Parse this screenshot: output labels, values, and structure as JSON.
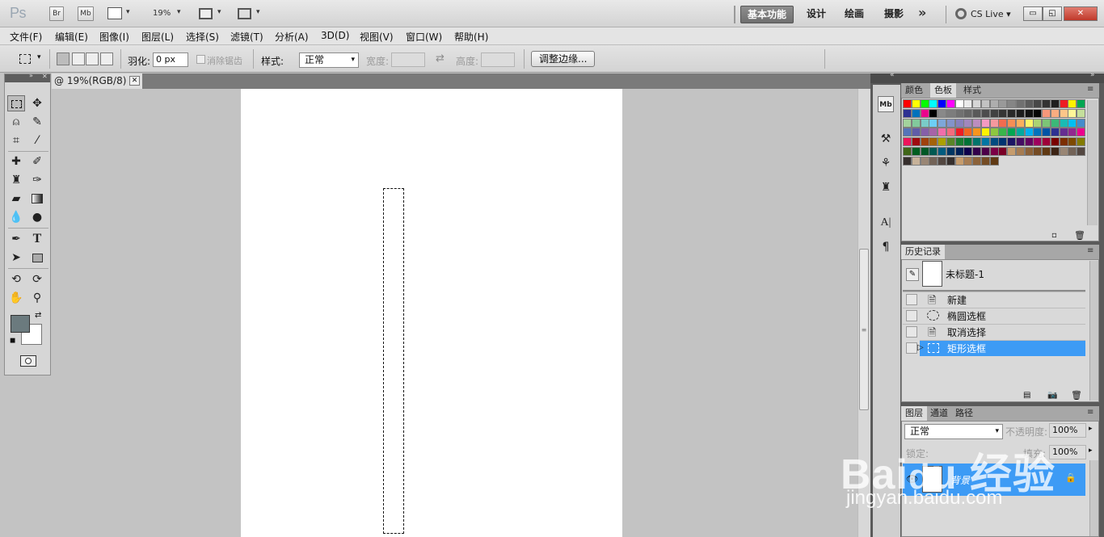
{
  "appbar": {
    "logo": "Ps",
    "br": "Br",
    "mb": "Mb",
    "zoom": "19%",
    "dropdown": "▾",
    "workspaces": [
      "基本功能",
      "设计",
      "绘画",
      "摄影"
    ],
    "more": "»",
    "cslive": "CS Live",
    "win_min": "▭",
    "win_max": "◱",
    "win_close": "✕"
  },
  "menu": [
    "文件(F)",
    "编辑(E)",
    "图像(I)",
    "图层(L)",
    "选择(S)",
    "滤镜(T)",
    "分析(A)",
    "3D(D)",
    "视图(V)",
    "窗口(W)",
    "帮助(H)"
  ],
  "options": {
    "feather_label": "羽化:",
    "feather_value": "0 px",
    "antialias_label": "消除锯齿",
    "style_label": "样式:",
    "style_value": "正常",
    "width_label": "宽度:",
    "height_label": "高度:",
    "refine_button": "调整边缘..."
  },
  "document": {
    "tab_title": "@ 19%(RGB/8) *",
    "tab_close": "✕"
  },
  "panels": {
    "color_tabs": [
      "颜色",
      "色板",
      "样式"
    ],
    "history_title": "历史记录",
    "history_snapshot": "未标题-1",
    "history_items": [
      "新建",
      "椭圆选框",
      "取消选择",
      "矩形选框"
    ],
    "layers_tabs": [
      "图层",
      "通道",
      "路径"
    ],
    "blend_mode": "正常",
    "opacity_label": "不透明度:",
    "opacity_value": "100%",
    "fill_label": "填充:",
    "fill_value": "100%",
    "lock_label": "锁定:",
    "layer_name": "背景"
  },
  "swatch_colors": [
    [
      "#ff0000",
      "#ffff00",
      "#00ff00",
      "#00ffff",
      "#0000ff",
      "#ff00ff",
      "#ffffff",
      "#ebebeb",
      "#d6d6d6",
      "#c2c2c2",
      "#adadad",
      "#999999",
      "#858585",
      "#707070",
      "#5c5c5c",
      "#474747",
      "#333333",
      "#1f1f1f",
      "#ee1d24",
      "#fff200",
      "#00a651"
    ],
    [
      "#2e3192",
      "#0072bc",
      "#ec008c",
      "#000000",
      "#898989",
      "#7d7d7d",
      "#717171",
      "#656565",
      "#595959",
      "#4d4d4d",
      "#414141",
      "#353535",
      "#292929",
      "#1d1d1d",
      "#111111",
      "#050505",
      "#f7977a",
      "#f9ad81",
      "#fdc689",
      "#fff799",
      "#c4df9b"
    ],
    [
      "#a3d39c",
      "#82ca9c",
      "#7accc8",
      "#6dcff6",
      "#7da7d9",
      "#8393ca",
      "#8781bd",
      "#a187be",
      "#bc8dbf",
      "#f49ac2",
      "#f6989d",
      "#f26c4f",
      "#f68e55",
      "#fbaf5d",
      "#fff568",
      "#acd372",
      "#7cc576",
      "#3bb878",
      "#1abbb4",
      "#00bff3",
      "#438ccb"
    ],
    [
      "#5574b9",
      "#605ca8",
      "#855fa8",
      "#a763a8",
      "#f06eaa",
      "#f26d7d",
      "#ed1c24",
      "#f26522",
      "#f7941d",
      "#fff200",
      "#8dc63f",
      "#39b54a",
      "#00a651",
      "#00a99d",
      "#00aeef",
      "#0072bc",
      "#0054a6",
      "#2e3192",
      "#662d91",
      "#92278f",
      "#ec008c"
    ],
    [
      "#ed145b",
      "#9e0b0f",
      "#a0410d",
      "#a36209",
      "#aba000",
      "#598527",
      "#197b30",
      "#007236",
      "#00746b",
      "#0076a3",
      "#004b80",
      "#003471",
      "#1b1464",
      "#440e62",
      "#630460",
      "#9e005d",
      "#9e0039",
      "#790000",
      "#7b2e00",
      "#7d4900",
      "#827b00"
    ],
    [
      "#406618",
      "#005e20",
      "#005826",
      "#005952",
      "#005b7f",
      "#003663",
      "#002157",
      "#0d004c",
      "#32004b",
      "#4b0049",
      "#7b0046",
      "#7a0026",
      "#c69c6d",
      "#a67c52",
      "#8c6239",
      "#754c24",
      "#603913",
      "#3c2415",
      "#998675",
      "#736357",
      "#534741"
    ],
    [
      "#362f2d",
      "#c7b299",
      "#998675",
      "#736357",
      "#534741",
      "#362f2d",
      "#c69c6d",
      "#a67c52",
      "#8c6239",
      "#754c24",
      "#603913"
    ]
  ]
}
